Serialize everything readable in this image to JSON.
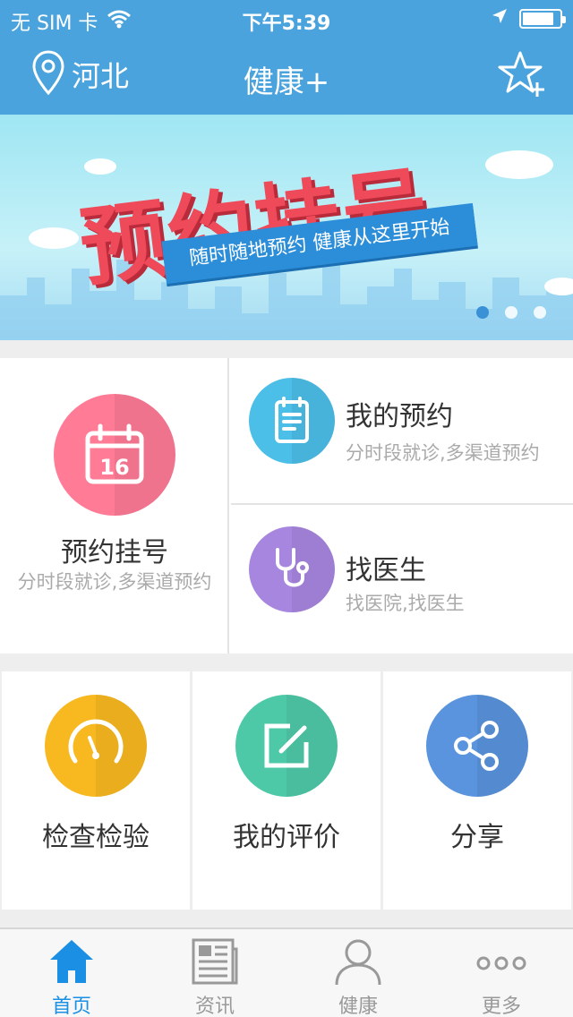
{
  "status_bar": {
    "carrier": "无 SIM 卡",
    "time": "下午5:39",
    "battery_level": 0.85
  },
  "nav": {
    "location": "河北",
    "title": "健康+",
    "location_icon": "map-pin-icon",
    "favorite_icon": "star-plus-icon"
  },
  "banner": {
    "title": "预约挂号",
    "subtitle": "随时随地预约  健康从这里开始",
    "pages": 3,
    "active_page": 1
  },
  "main": {
    "appointment": {
      "label": "预约挂号",
      "sub": "分时段就诊,多渠道预约",
      "color": "#ff7b96",
      "icon_text": "16"
    },
    "my_appointments": {
      "label": "我的预约",
      "sub": "分时段就诊,多渠道预约",
      "color": "#4cbfe8"
    },
    "find_doctor": {
      "label": "找医生",
      "sub": "找医院,找医生",
      "color": "#a786e0"
    }
  },
  "tiles": [
    {
      "label": "检查检验",
      "color": "#f8b820"
    },
    {
      "label": "我的评价",
      "color": "#4ec9a8"
    },
    {
      "label": "分享",
      "color": "#5a94de"
    }
  ],
  "tabbar": {
    "tabs": [
      {
        "label": "首页",
        "icon": "home-icon",
        "active": true
      },
      {
        "label": "资讯",
        "icon": "news-icon",
        "active": false
      },
      {
        "label": "健康",
        "icon": "person-icon",
        "active": false
      },
      {
        "label": "更多",
        "icon": "more-icon",
        "active": false
      }
    ],
    "active_color": "#1a8fe3",
    "inactive_color": "#999999"
  }
}
